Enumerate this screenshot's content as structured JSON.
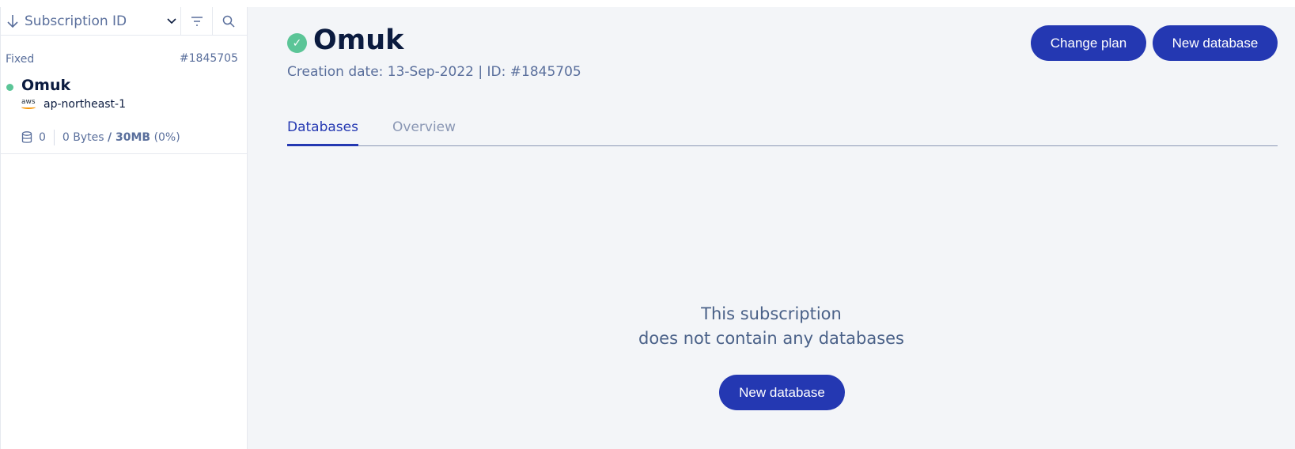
{
  "sidebar": {
    "sort_label": "Subscription ID",
    "subscription": {
      "type": "Fixed",
      "id": "#1845705",
      "name": "Omuk",
      "region": "ap-northeast-1",
      "aws_text": "aws",
      "db_count": "0",
      "usage_used": "0 Bytes",
      "usage_limit": "/ 30MB",
      "usage_pct": "(0%)",
      "status_color": "#5bc597"
    }
  },
  "header": {
    "title": "Omuk",
    "creation_info": "Creation date: 13-Sep-2022 | ID: #1845705",
    "change_plan_label": "Change plan",
    "new_database_label": "New database"
  },
  "tabs": {
    "databases": "Databases",
    "overview": "Overview",
    "active": "Databases"
  },
  "empty_state": {
    "line1": "This subscription",
    "line2": "does not contain any databases",
    "button_label": "New database"
  },
  "colors": {
    "accent": "#2438b2",
    "status_ok": "#5bc597",
    "muted_text": "#5a6f9c"
  },
  "icons": [
    "sort-down-icon",
    "chevron-down-icon",
    "filter-icon",
    "search-icon",
    "check-icon",
    "database-icon",
    "aws-logo"
  ]
}
